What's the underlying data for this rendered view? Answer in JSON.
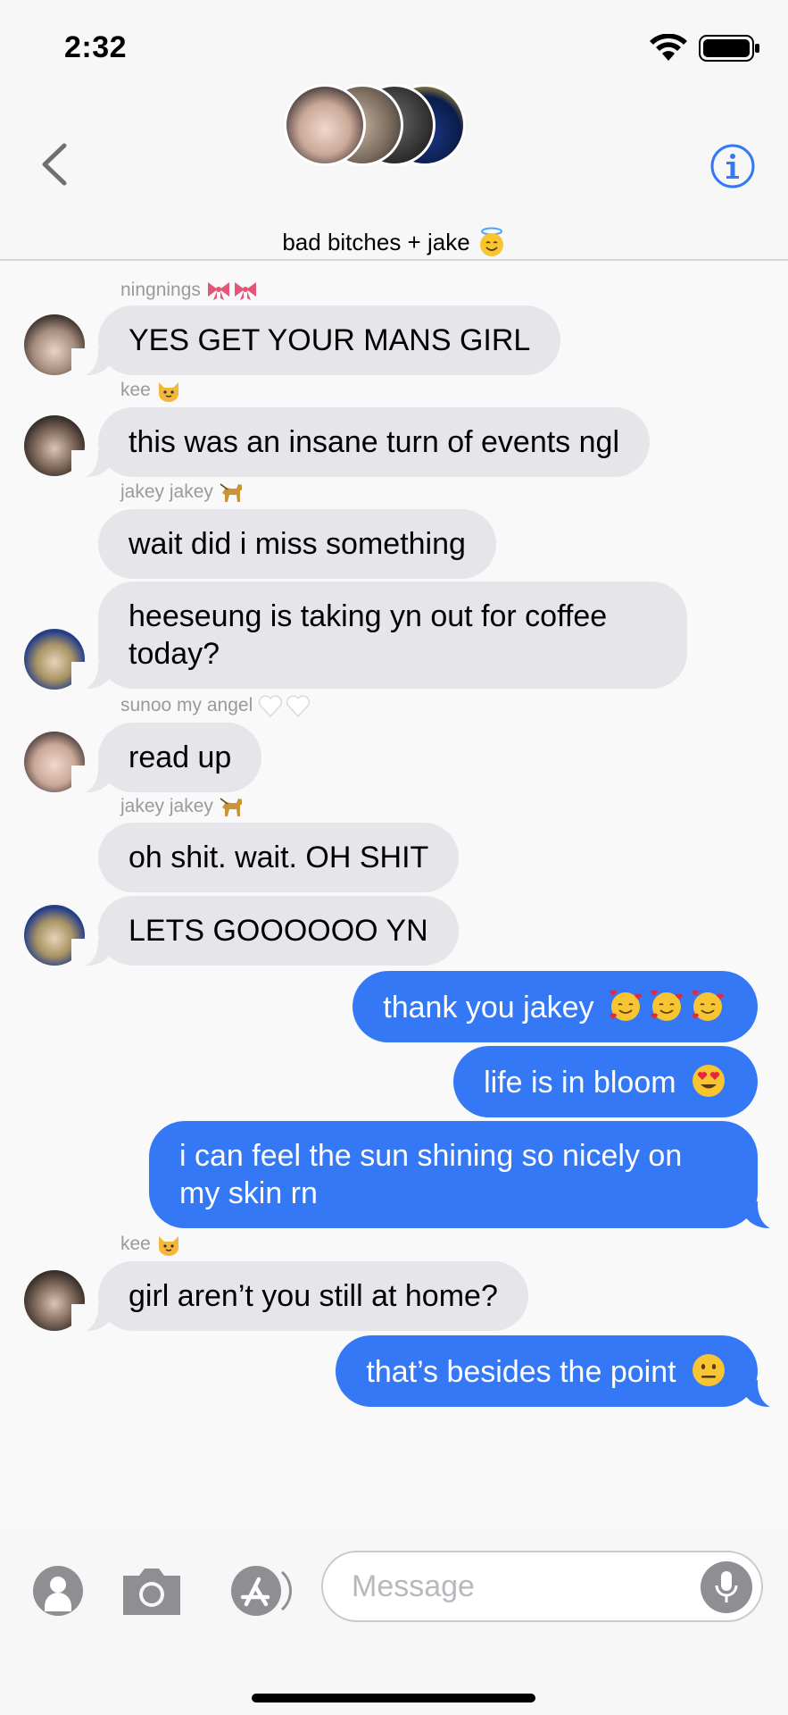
{
  "status": {
    "time": "2:32"
  },
  "header": {
    "group_name": "bad bitches + jake",
    "group_emoji": "smiling-face-with-halo"
  },
  "messages": [
    {
      "sender": "ningnings",
      "sender_emoji": "ribbon",
      "text": "YES GET YOUR MANS GIRL"
    },
    {
      "sender": "kee",
      "sender_emoji": "cat-face",
      "text": "this was an insane turn of events ngl"
    },
    {
      "sender": "jakey jakey",
      "sender_emoji": "guide-dog",
      "text": "wait did i miss something"
    },
    {
      "text": "heeseung is taking yn out for coffee today?"
    },
    {
      "sender": "sunoo my angel",
      "sender_emoji": "white-heart",
      "text": "read up"
    },
    {
      "sender": "jakey jakey",
      "sender_emoji": "guide-dog",
      "text": "oh shit. wait. OH SHIT"
    },
    {
      "text": "LETS GOOOOOO YN"
    },
    {
      "text": "thank you jakey",
      "emoji": "smiling-face-with-hearts"
    },
    {
      "text": "life is in bloom",
      "emoji": "heart-eyes"
    },
    {
      "text": "i can feel the sun shining so nicely on my skin rn"
    },
    {
      "sender": "kee",
      "sender_emoji": "cat-face",
      "text": "girl aren’t you still at home?"
    },
    {
      "text": "that’s besides the point",
      "emoji": "neutral-face"
    }
  ],
  "compose": {
    "placeholder": "Message"
  },
  "colors": {
    "outgoing": "#3478f6",
    "incoming": "#e5e5ea",
    "accent": "#3478f6"
  }
}
